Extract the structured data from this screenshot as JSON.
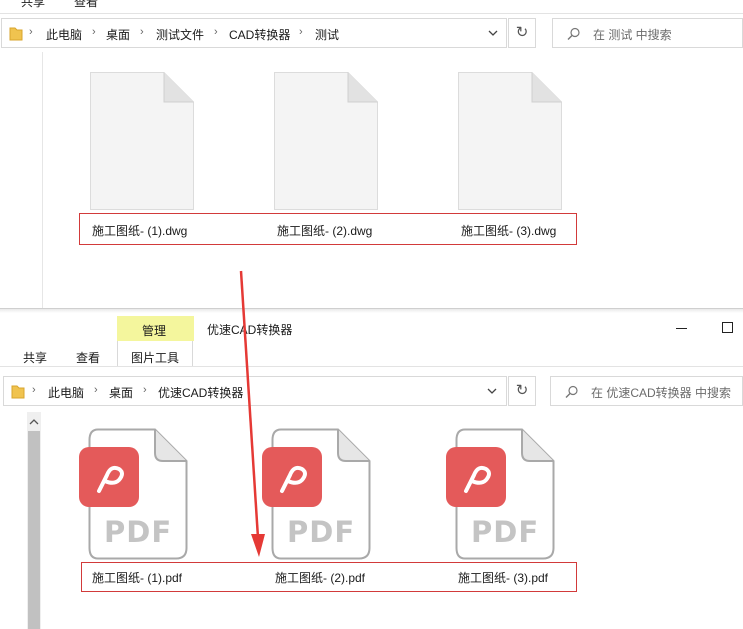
{
  "top_window": {
    "ribbon_tabs": [
      "共享",
      "查看"
    ],
    "breadcrumb": [
      "此电脑",
      "桌面",
      "测试文件",
      "CAD转换器",
      "测试"
    ],
    "search_placeholder": "在 测试 中搜索",
    "files": [
      "施工图纸- (1).dwg",
      "施工图纸- (2).dwg",
      "施工图纸- (3).dwg"
    ]
  },
  "bottom_window": {
    "manage_tab": "管理",
    "window_title": "优速CAD转换器",
    "ribbon_tabs": [
      "共享",
      "查看",
      "图片工具"
    ],
    "breadcrumb": [
      "此电脑",
      "桌面",
      "优速CAD转换器"
    ],
    "search_placeholder": "在 优速CAD转换器 中搜索",
    "pdf_badge": "PDF",
    "files": [
      "施工图纸- (1).pdf",
      "施工图纸- (2).pdf",
      "施工图纸- (3).pdf"
    ]
  },
  "colors": {
    "manage_tab_bg": "#f4f69d",
    "highlight_box": "#d23a3a",
    "arrow": "#e53935",
    "pdf_icon": "#e45a5a"
  },
  "icons": [
    "folder-icon",
    "chevron-right-icon",
    "chevron-down-icon",
    "refresh-icon",
    "search-icon",
    "minimize-icon",
    "maximize-icon",
    "scroll-up-icon",
    "pdf-logo-icon"
  ]
}
